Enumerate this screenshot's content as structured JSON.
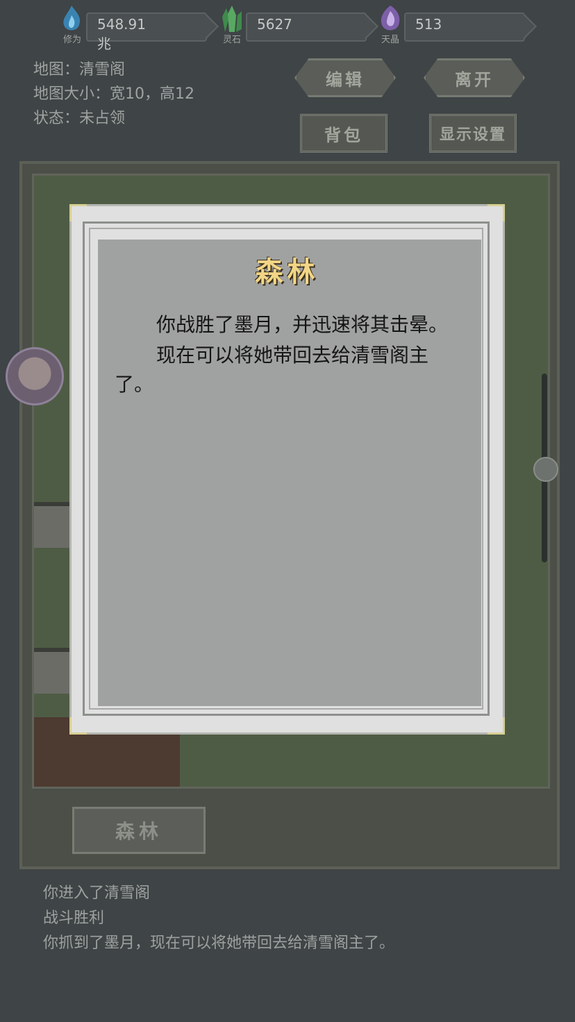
{
  "resources": [
    {
      "label": "修为",
      "value": "548.91兆",
      "icon": "blue-flame-icon",
      "color": "#3a8ec4"
    },
    {
      "label": "灵石",
      "value": "5627",
      "icon": "green-crystal-icon",
      "color": "#3f8a4c"
    },
    {
      "label": "天晶",
      "value": "513",
      "icon": "purple-crystal-icon",
      "color": "#7d5fa8"
    }
  ],
  "map_info": {
    "name": "地图：清雪阁",
    "size": "地图大小：宽10，高12",
    "status": "状态：未占领"
  },
  "buttons": {
    "edit": "编辑",
    "leave": "离开",
    "bag": "背包",
    "display_settings": "显示设置",
    "location": "森林"
  },
  "dialog": {
    "title": "森林",
    "paragraphs": [
      "你战胜了墨月，并迅速将其击晕。",
      "现在可以将她带回去给清雪阁主了。"
    ]
  },
  "log": [
    "你进入了清雪阁",
    "战斗胜利",
    "你抓到了墨月，现在可以将她带回去给清雪阁主了。"
  ]
}
